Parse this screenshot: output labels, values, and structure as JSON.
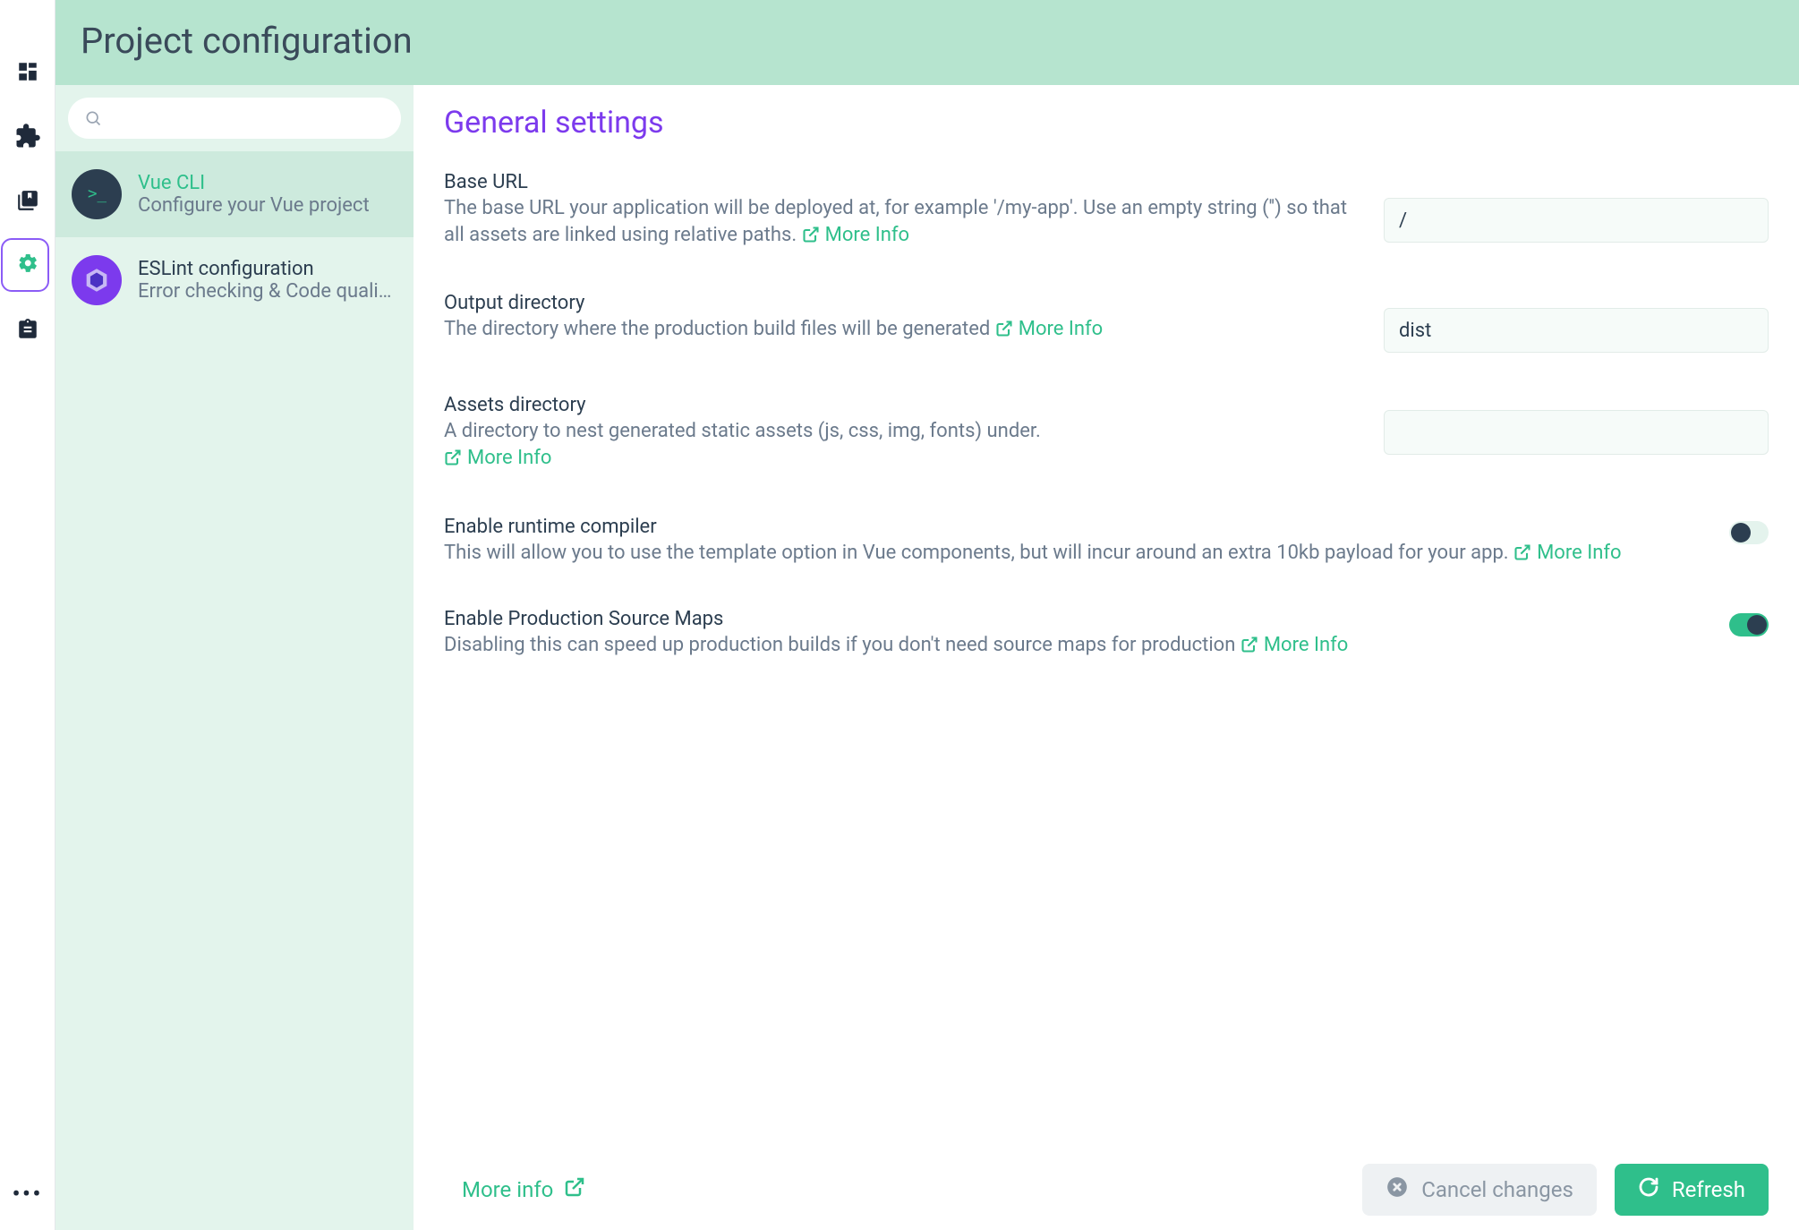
{
  "header": {
    "title": "Project configuration"
  },
  "sidebar": {
    "search_placeholder": "",
    "items": [
      {
        "title": "Vue CLI",
        "subtitle": "Configure your Vue project"
      },
      {
        "title": "ESLint configuration",
        "subtitle": "Error checking & Code quali…"
      }
    ]
  },
  "panel": {
    "heading": "General settings",
    "more_info_label": "More Info",
    "bottom_more_info": "More info",
    "cancel_label": "Cancel changes",
    "refresh_label": "Refresh",
    "fields": {
      "base_url": {
        "name": "Base URL",
        "desc": "The base URL your application will be deployed at, for example '/my-app'. Use an empty string ('') so that all assets are linked using relative paths.",
        "value": "/"
      },
      "output_dir": {
        "name": "Output directory",
        "desc": "The directory where the production build files will be generated",
        "value": "dist"
      },
      "assets_dir": {
        "name": "Assets directory",
        "desc": "A directory to nest generated static assets (js, css, img, fonts) under.",
        "value": ""
      },
      "runtime_compiler": {
        "name": "Enable runtime compiler",
        "desc": "This will allow you to use the template option in Vue components, but will incur around an extra 10kb payload for your app.",
        "on": false
      },
      "source_maps": {
        "name": "Enable Production Source Maps",
        "desc": "Disabling this can speed up production builds if you don't need source maps for production",
        "on": true
      }
    }
  }
}
